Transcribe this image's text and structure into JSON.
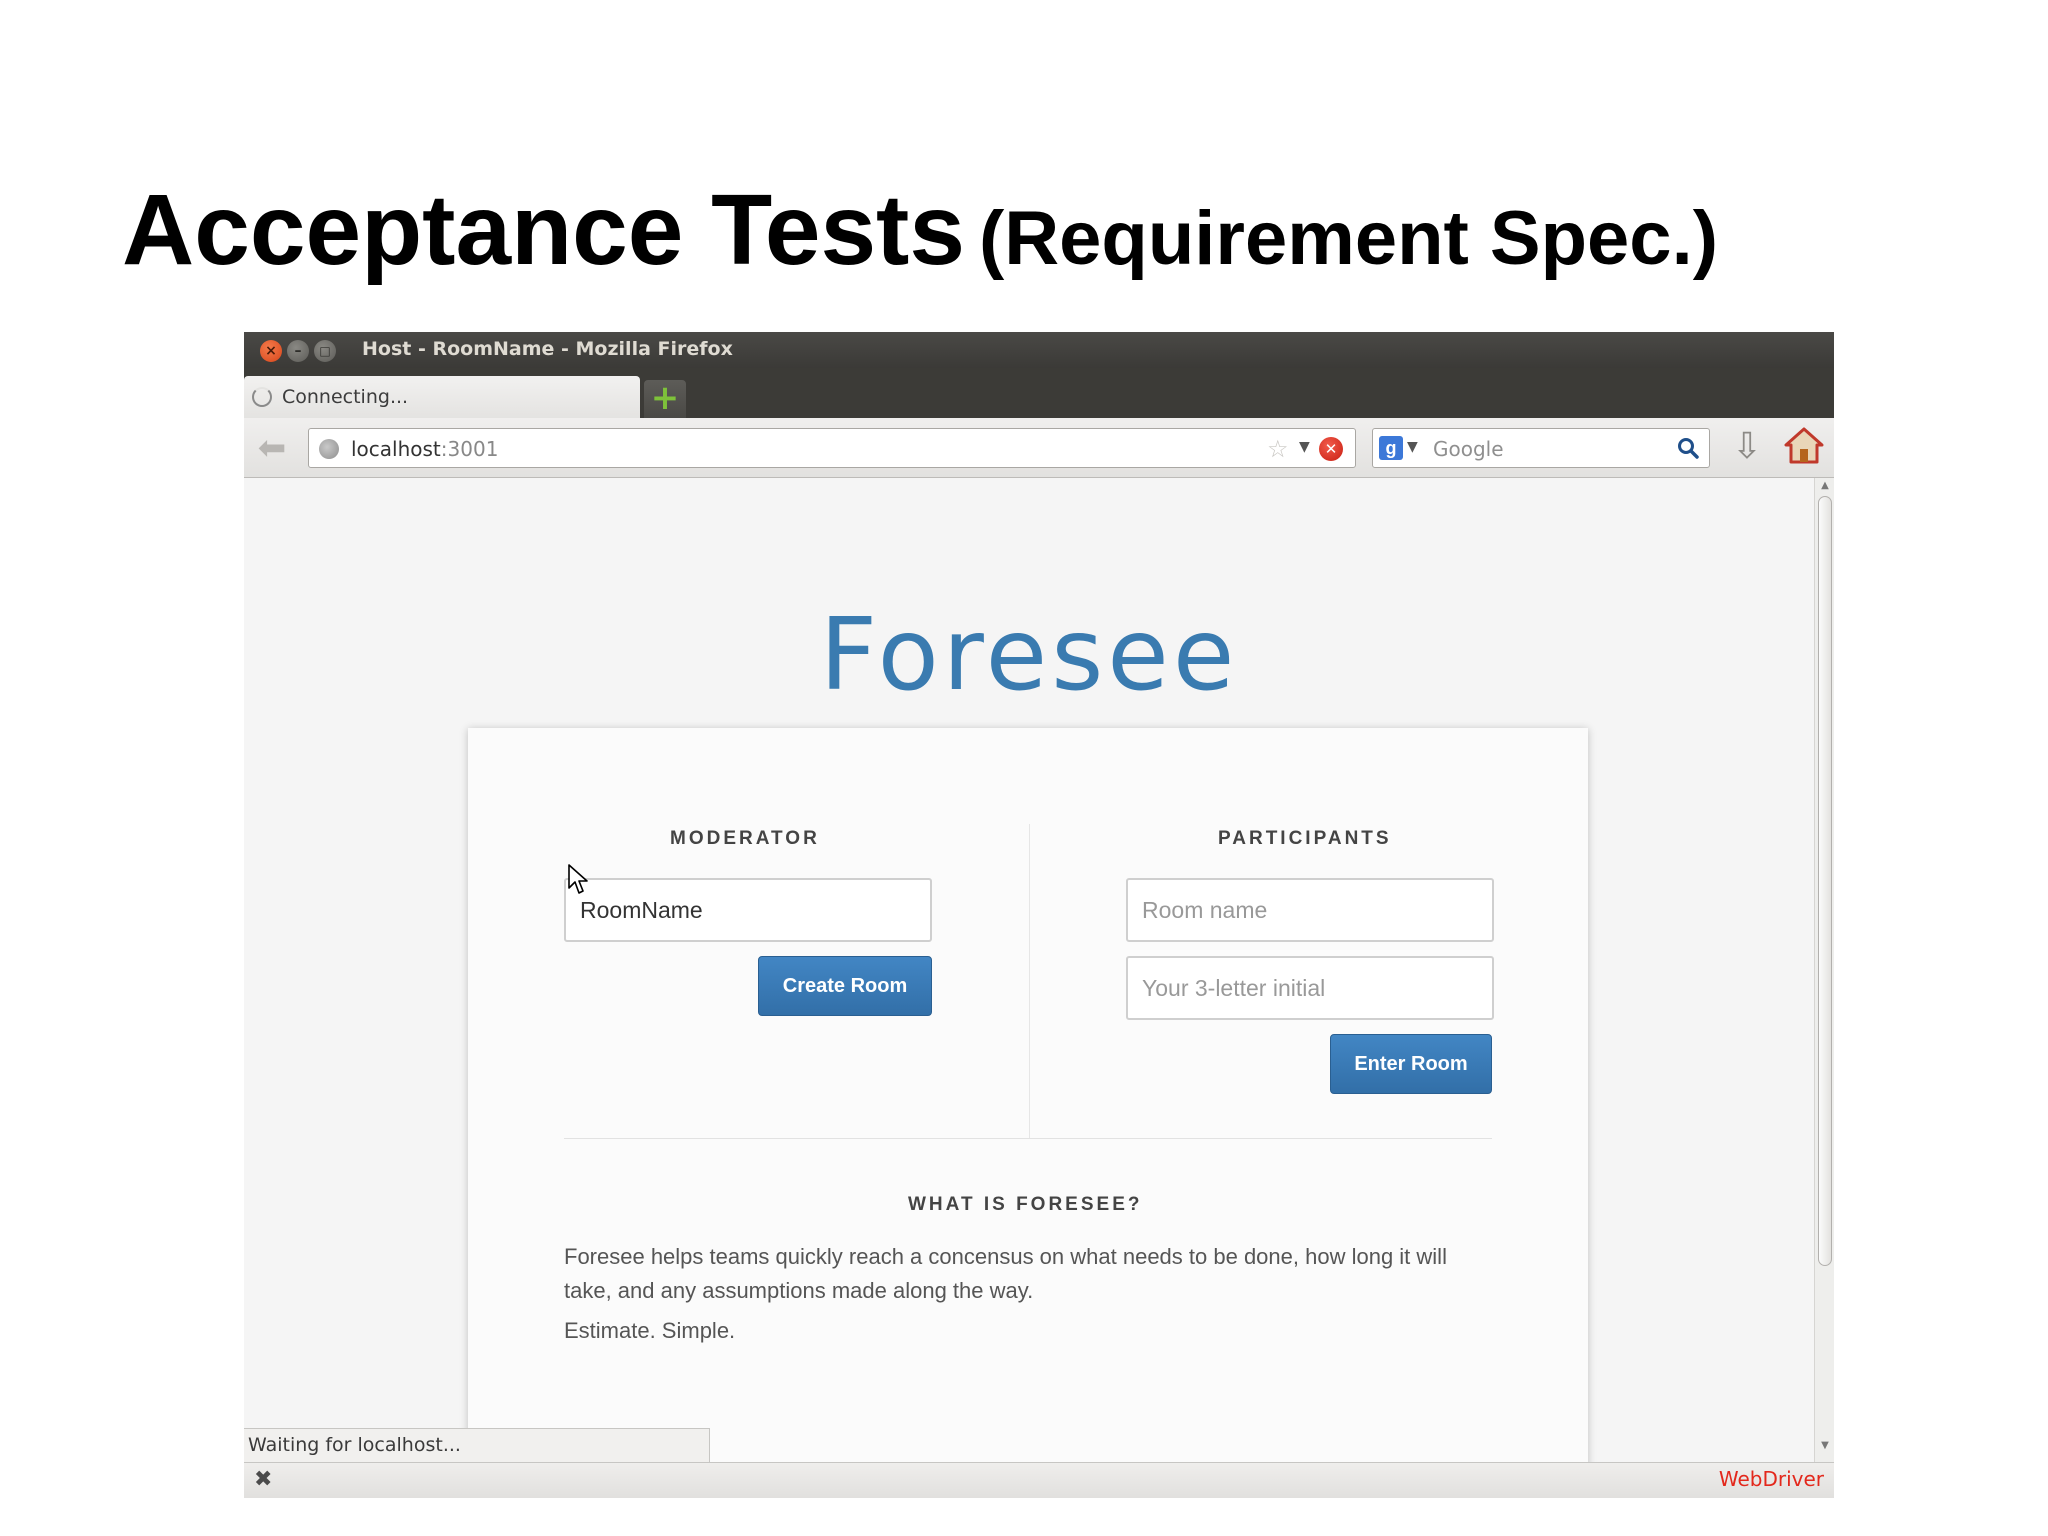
{
  "slide": {
    "title_main": "Acceptance Tests",
    "title_sub": "(Requirement Spec.)"
  },
  "browser": {
    "window_title": "Host - RoomName - Mozilla Firefox",
    "tab_label": "Connecting...",
    "url_host": "localhost",
    "url_port": ":3001",
    "search_placeholder": "Google",
    "search_engine_icon": "g",
    "status_text": "Waiting for localhost...",
    "addon_label": "WebDriver"
  },
  "page": {
    "brand": "Foresee",
    "moderator": {
      "heading": "MODERATOR",
      "room_value": "RoomName",
      "create_label": "Create Room"
    },
    "participants": {
      "heading": "PARTICIPANTS",
      "room_placeholder": "Room name",
      "initial_placeholder": "Your 3-letter initial",
      "enter_label": "Enter Room"
    },
    "about": {
      "heading": "WHAT IS FORESEE?",
      "paragraph1_line1": "Foresee helps teams quickly reach a concensus on what needs to be done, how long it will",
      "paragraph1_line2": "take, and any assumptions made along the way.",
      "paragraph2": "Estimate. Simple."
    }
  },
  "colors": {
    "brand_blue": "#3a7bb0",
    "button_blue": "#3a7bb8",
    "webdriver_red": "#e3281c"
  }
}
